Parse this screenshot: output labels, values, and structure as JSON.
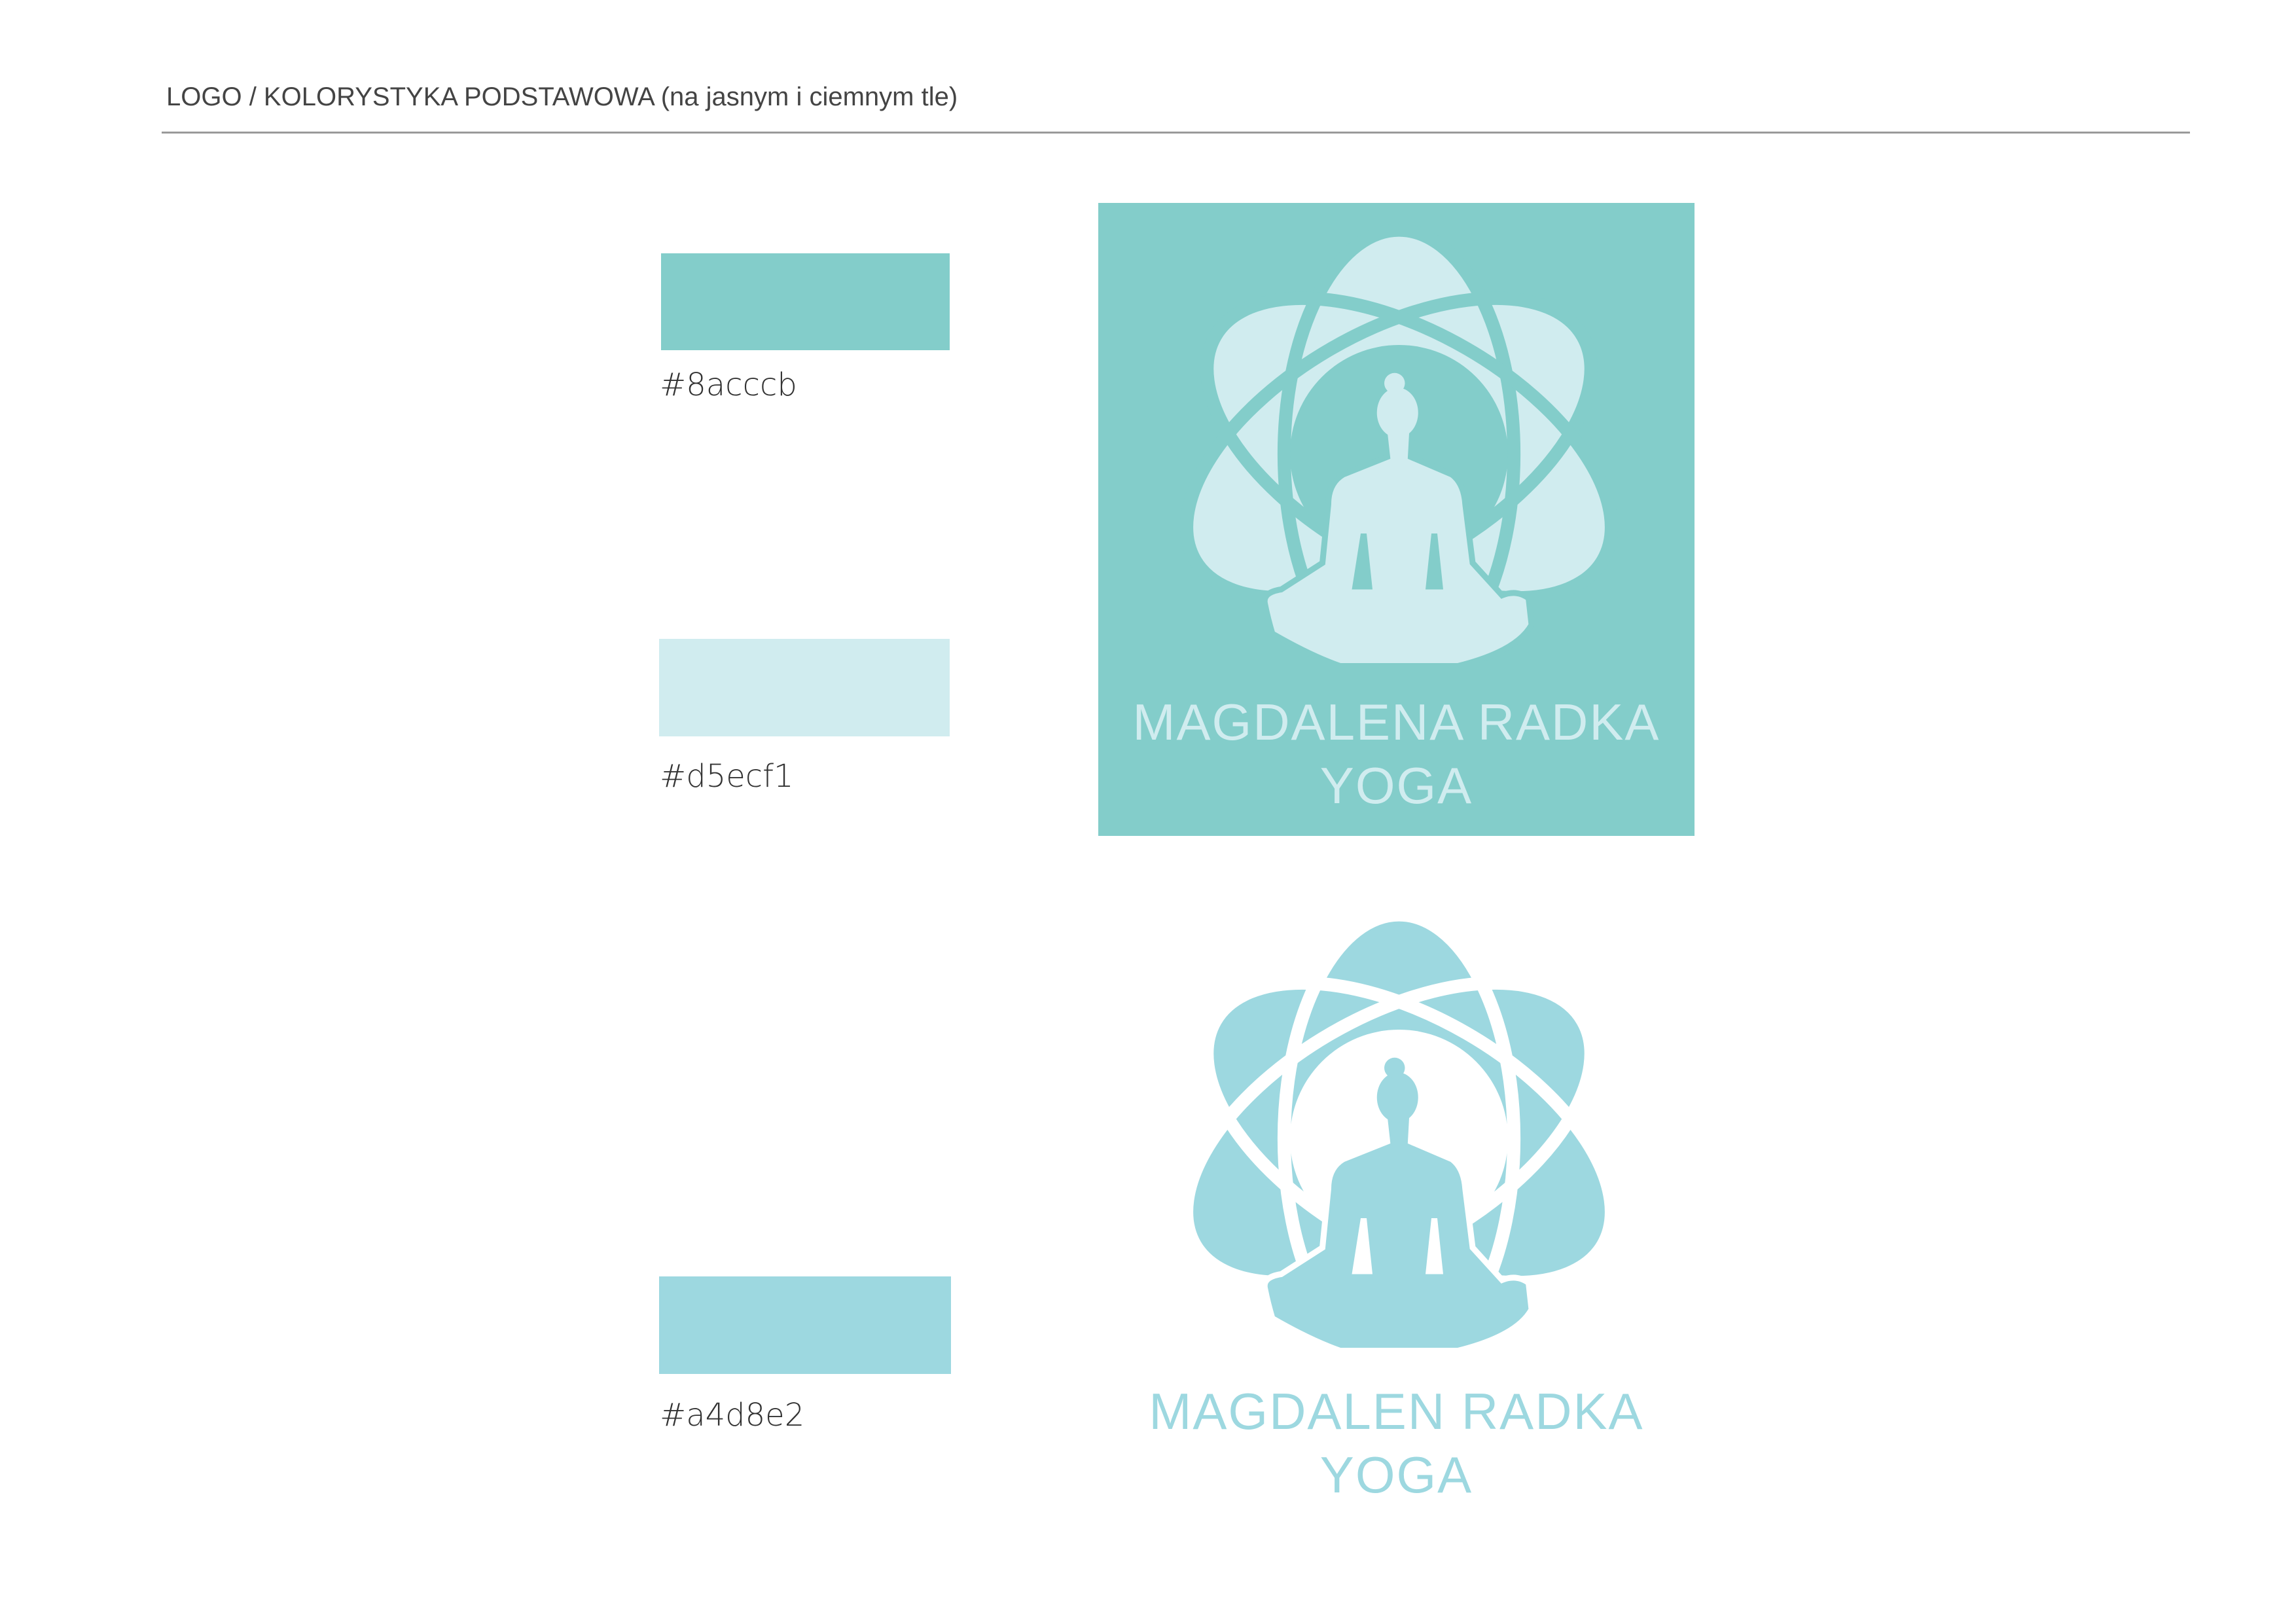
{
  "header": {
    "title": "LOGO / KOLORYSTYKA PODSTAWOWA (na jasnym i ciemnym tle)"
  },
  "colors": {
    "primary": "#8acccb",
    "light": "#d5ecf1",
    "blue": "#a4d8e2"
  },
  "swatches": [
    {
      "label": "#8acccb",
      "color": "#83cdca"
    },
    {
      "label": "#d5ecf1",
      "color": "#d0ecef"
    },
    {
      "label": "#a4d8e2",
      "color": "#9dd8e0"
    }
  ],
  "logo_dark": {
    "line1": "MAGDALENA RADKA",
    "line2": "YOGA",
    "bg": "#83cdca",
    "fg": "#d0ecef"
  },
  "logo_light": {
    "line1": "MAGDALEN RADKA",
    "line2": "YOGA",
    "bg": "#ffffff",
    "fg": "#9dd8e0"
  }
}
